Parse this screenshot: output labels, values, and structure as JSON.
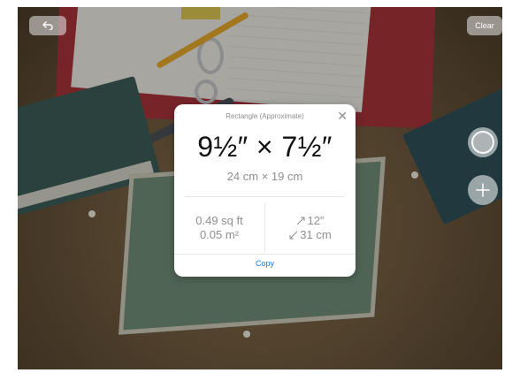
{
  "toolbar": {
    "undo_icon": "undo-icon",
    "clear_label": "Clear"
  },
  "controls": {
    "shutter_icon": "shutter-icon",
    "add_icon": "plus-icon"
  },
  "measurement_card": {
    "title": "Rectangle (Approximate)",
    "close_icon": "close-icon",
    "dimensions_imperial": "9½″ × 7½″",
    "dimensions_metric": "24 cm × 19 cm",
    "area_imperial": "0.49 sq ft",
    "area_metric": "0.05 m²",
    "diagonal_imperial": "12″",
    "diagonal_metric": "31 cm",
    "diagonal_icon": "diagonal-arrow-icon",
    "copy_label": "Copy"
  },
  "colors": {
    "accent": "#1a7cf5",
    "secondary_text": "#8e8e93"
  }
}
